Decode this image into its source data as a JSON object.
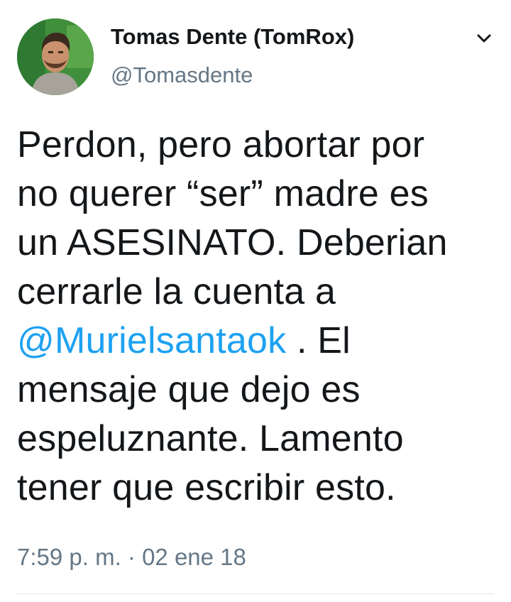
{
  "tweet": {
    "author": {
      "display_name": "Tomas Dente (TomRox)",
      "handle": "@Tomasdente",
      "avatar_icon": "profile-photo"
    },
    "menu_icon": "chevron-down-icon",
    "text": {
      "line1": "Perdon, pero abortar por",
      "line2": "no querer “ser” madre es",
      "line3": "un ASESINATO. Deberian",
      "line4": "cerrarle la cuenta a",
      "line5_mention": "@Murielsantaok",
      "line5_rest": " . El",
      "line6": "mensaje que dejo es",
      "line7": "espeluznante. Lamento",
      "line8": "tener que escribir esto."
    },
    "timestamp": "7:59 p. m. · 02 ene 18",
    "colors": {
      "link": "#1da1f2",
      "secondary_text": "#657786",
      "primary_text": "#14171a",
      "divider": "#e1e8ed"
    }
  }
}
